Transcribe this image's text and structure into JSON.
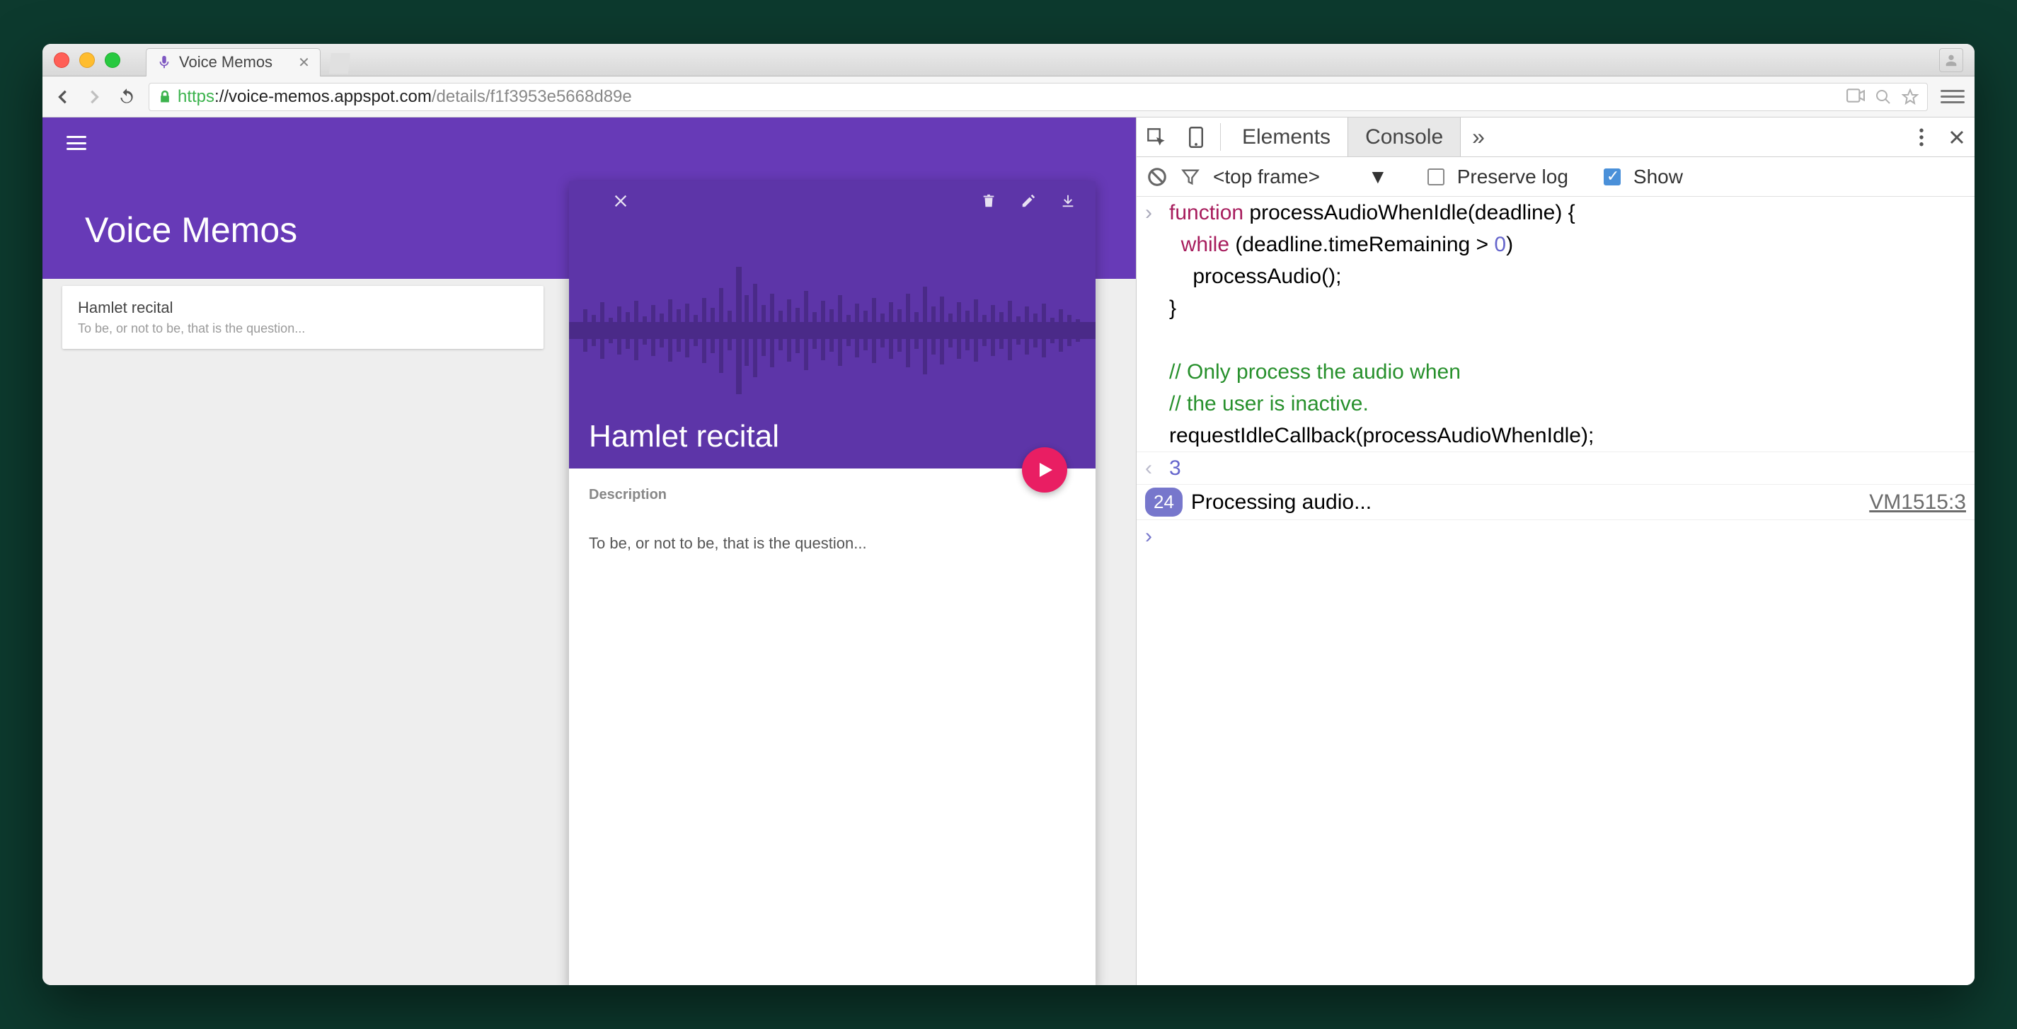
{
  "browser": {
    "tab_title": "Voice Memos",
    "url_proto": "https",
    "url_host": "://voice-memos.appspot.com",
    "url_path": "/details/f1f3953e5668d89e"
  },
  "app": {
    "title": "Voice Memos",
    "list": {
      "item_title": "Hamlet recital",
      "item_subtitle": "To be, or not to be, that is the question..."
    },
    "detail": {
      "title": "Hamlet recital",
      "desc_label": "Description",
      "description": "To be, or not to be, that is the question..."
    }
  },
  "devtools": {
    "tabs": {
      "elements": "Elements",
      "console": "Console",
      "more": "»"
    },
    "toolbar": {
      "frame_label": "<top frame>",
      "preserve_label": "Preserve log",
      "show_label": "Show"
    },
    "console": {
      "code": "function processAudioWhenIdle(deadline) {\n  while (deadline.timeRemaining > 0)\n    processAudio();\n}\n\n// Only process the audio when\n// the user is inactive.\nrequestIdleCallback(processAudioWhenIdle);",
      "return_value": "3",
      "log_count": "24",
      "log_text": "Processing audio...",
      "log_source": "VM1515:3"
    }
  }
}
